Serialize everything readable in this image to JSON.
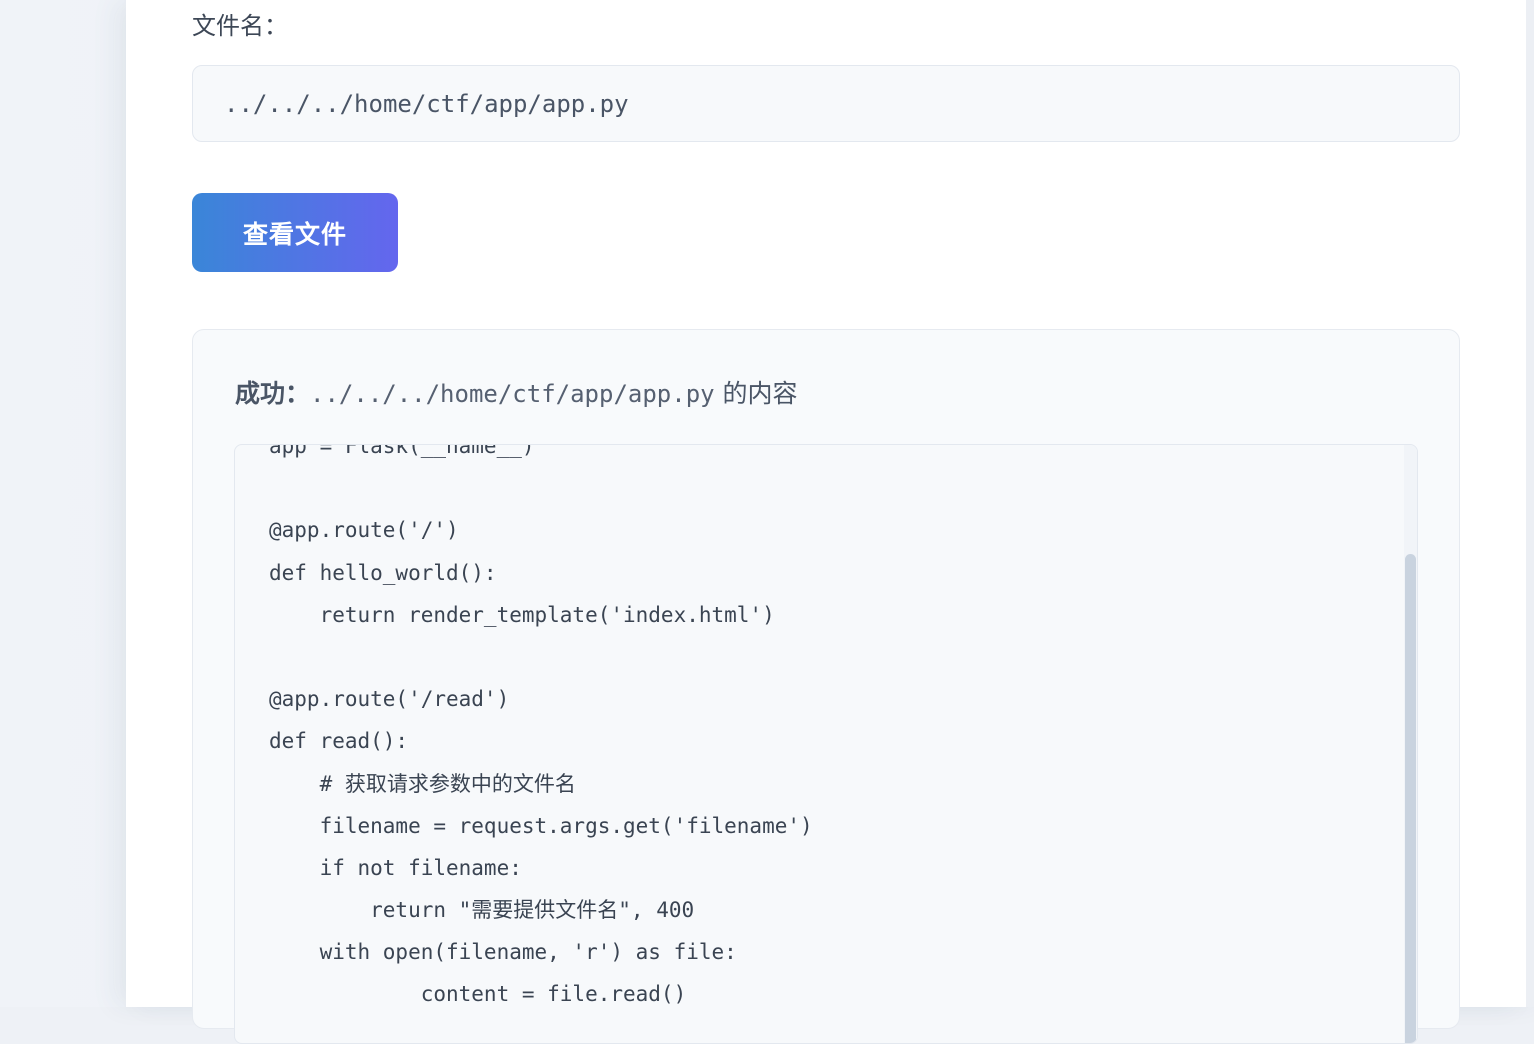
{
  "form": {
    "filename_label": "文件名：",
    "filename_value": "../../../home/ctf/app/app.py",
    "submit_label": "查看文件"
  },
  "result": {
    "status": "成功：",
    "path": "../../../home/ctf/app/app.py",
    "suffix": " 的内容",
    "code_lines": [
      "app = Flask(__name__)",
      "",
      "@app.route('/')",
      "def hello_world():",
      "    return render_template('index.html')",
      "",
      "@app.route('/read')",
      "def read():",
      "    # 获取请求参数中的文件名",
      "    filename = request.args.get('filename')",
      "    if not filename:",
      "        return \"需要提供文件名\", 400",
      "    with open(filename, 'r') as file:",
      "            content = file.read()"
    ]
  }
}
